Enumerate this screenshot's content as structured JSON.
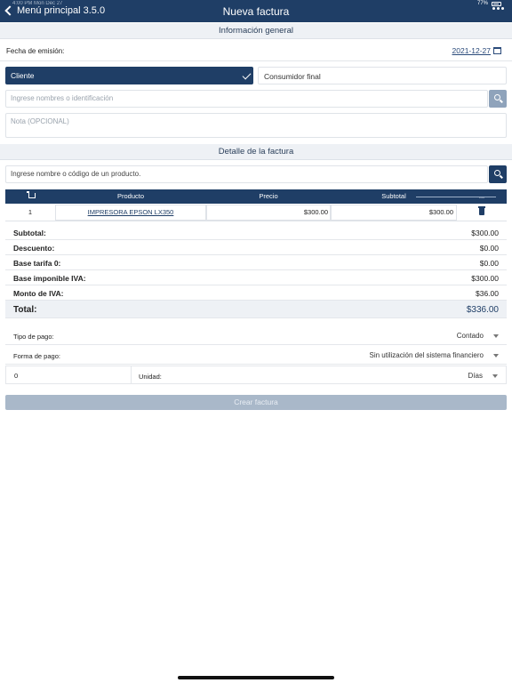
{
  "status_bar": {
    "time": "4:00 PM",
    "date": "Mon Dec 27",
    "battery": "77%"
  },
  "nav": {
    "back_label": "Menú principal 3.5.0",
    "title": "Nueva factura"
  },
  "general": {
    "header": "Información general",
    "issue_date_label": "Fecha de emisión:",
    "issue_date_value": "2021-12-27",
    "segment_client": "Cliente",
    "segment_final": "Consumidor final",
    "client_placeholder": "Ingrese nombres o identificación",
    "note_placeholder": "Nota (OPCIONAL)"
  },
  "detail": {
    "header": "Detalle de la factura",
    "product_search_placeholder": "Ingrese nombre o código de un producto.",
    "columns": {
      "product": "Producto",
      "price": "Precio",
      "subtotal": "Subtotal",
      "actions": "..."
    },
    "rows": [
      {
        "qty": "1",
        "product": "IMPRESORA EPSON LX350",
        "price": "$300.00",
        "subtotal": "$300.00"
      }
    ]
  },
  "totals": [
    {
      "label": "Subtotal:",
      "value": "$300.00"
    },
    {
      "label": "Descuento:",
      "value": "$0.00"
    },
    {
      "label": "Base tarifa 0:",
      "value": "$0.00"
    },
    {
      "label": "Base imponible IVA:",
      "value": "$300.00"
    },
    {
      "label": "Monto de IVA:",
      "value": "$36.00"
    },
    {
      "label": "Total:",
      "value": "$336.00"
    }
  ],
  "payment": {
    "type_label": "Tipo de pago:",
    "type_value": "Contado",
    "method_label": "Forma de pago:",
    "method_value": "Sin utilización del sistema financiero",
    "term_value": "0",
    "unit_label": "Unidad:",
    "unit_value": "Días"
  },
  "create_button": "Crear factura",
  "colors": {
    "primary": "#1f3e66",
    "disabled_button": "#a9b8c9",
    "section_bg": "#eef1f5"
  }
}
